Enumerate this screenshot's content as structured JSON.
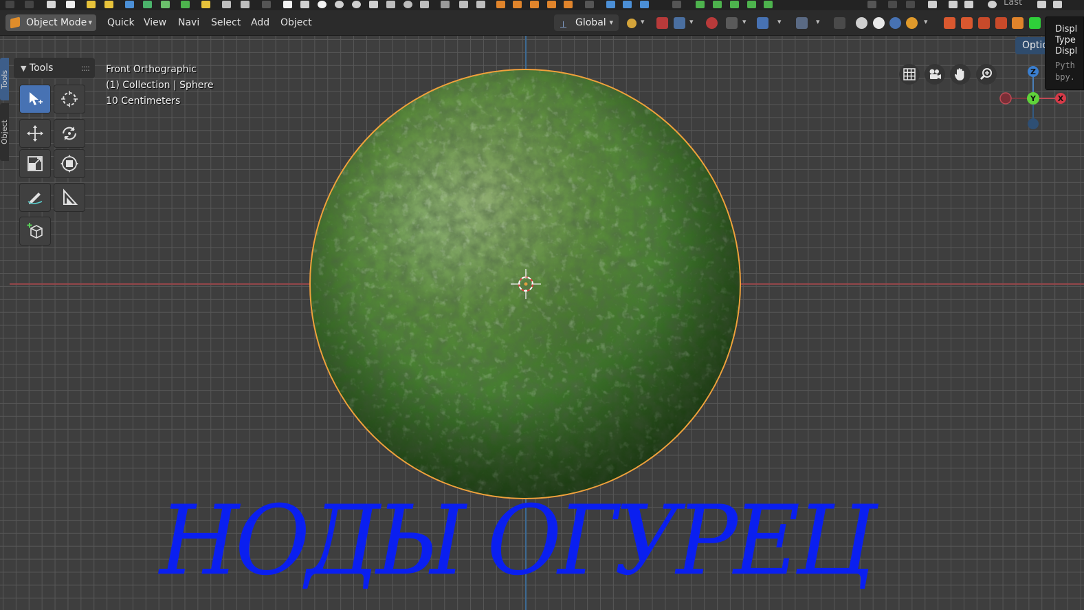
{
  "header": {
    "mode_label": "Object Mode",
    "menus": [
      "Quick",
      "View",
      "Navi",
      "Select",
      "Add",
      "Object"
    ],
    "orientation_label": "Global"
  },
  "side_tabs": {
    "tools": "Tools",
    "object": "Object"
  },
  "tools_panel": {
    "title": "Tools"
  },
  "viewport_info": {
    "view_name": "Front Orthographic",
    "collection": "(1) Collection | Sphere",
    "grid_scale": "10 Centimeters"
  },
  "options_label": "Optio",
  "top_strip": {
    "last_label": "Last"
  },
  "tooltip": {
    "lines": [
      "Displ",
      "Type",
      "Displ"
    ],
    "code": [
      "Pyth",
      "bpy."
    ]
  },
  "gizmo": {
    "x": "X",
    "y": "Y",
    "z": "Z"
  },
  "overlay_text": "НОДЫ ОГУРЕЦ",
  "colors": {
    "overlay_text": "#0a1ff0",
    "selection_outline": "#f0a13c",
    "active_tool": "#4772b3"
  }
}
